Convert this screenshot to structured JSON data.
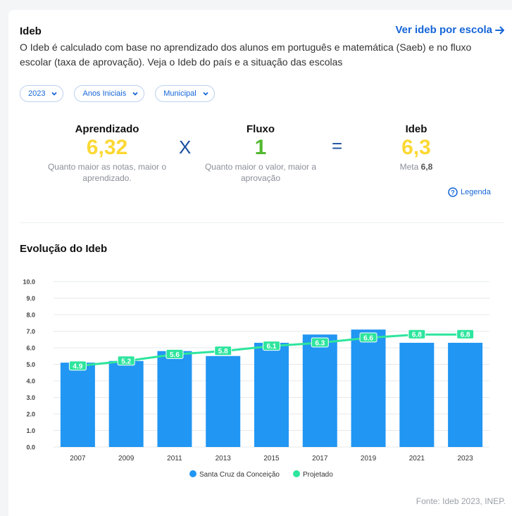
{
  "header": {
    "title": "Ideb",
    "link_label": "Ver ideb por escola",
    "description": "O Ideb é calculado com base no aprendizado dos alunos em português e matemática (Saeb) e no fluxo escolar (taxa de aprovação). Veja o Ideb do país e a situação das escolas"
  },
  "filters": {
    "year": "2023",
    "stage": "Anos Iniciais",
    "network": "Municipal"
  },
  "metrics": {
    "aprendizado": {
      "label": "Aprendizado",
      "value": "6,32",
      "caption": "Quanto maior as notas, maior o aprendizado."
    },
    "fluxo": {
      "label": "Fluxo",
      "value": "1",
      "caption": "Quanto maior o valor, maior a aprovação"
    },
    "ideb": {
      "label": "Ideb",
      "value": "6,3",
      "meta_prefix": "Meta",
      "meta_value": "6,8"
    },
    "op_times": "X",
    "op_equals": "="
  },
  "legenda_label": "Legenda",
  "evolution_title": "Evolução do Ideb",
  "source": "Fonte: Ideb 2023, INEP.",
  "colors": {
    "bar": "#2196f3",
    "projected": "#2ee59d",
    "accent": "#1565d8",
    "yellow": "#fcd835",
    "green": "#52b830"
  },
  "chart_data": {
    "type": "bar",
    "categories": [
      "2007",
      "2009",
      "2011",
      "2013",
      "2015",
      "2017",
      "2019",
      "2021",
      "2023"
    ],
    "ylim": [
      0,
      10
    ],
    "yticks": [
      "0.0",
      "1.0",
      "2.0",
      "3.0",
      "4.0",
      "5.0",
      "6.0",
      "7.0",
      "8.0",
      "9.0",
      "10.0"
    ],
    "series": [
      {
        "name": "Santa Cruz da Conceição",
        "type": "bar",
        "values": [
          5.1,
          5.2,
          5.8,
          5.5,
          6.3,
          6.8,
          7.1,
          6.3,
          6.3
        ]
      },
      {
        "name": "Projetado",
        "type": "line",
        "values": [
          4.9,
          5.2,
          5.6,
          5.8,
          6.1,
          6.3,
          6.6,
          6.8,
          6.8
        ],
        "labels": [
          "4.9",
          "5.2",
          "5.6",
          "5.8",
          "6.1",
          "6.3",
          "6.6",
          "6.8",
          "6.8"
        ]
      }
    ]
  }
}
